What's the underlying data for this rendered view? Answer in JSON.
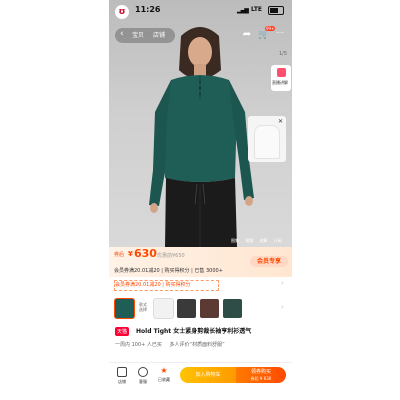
{
  "status": {
    "time": "11:26",
    "network": "LTE",
    "signal_icon": "signal-icon",
    "battery_icon": "battery-icon"
  },
  "nav": {
    "tabs": [
      "宝贝",
      "店铺"
    ],
    "pager": "1/5"
  },
  "live": {
    "label": "直播讲解"
  },
  "media_tabs": [
    "图集",
    "视频",
    "讲解",
    "尺码"
  ],
  "price": {
    "tag": "券后",
    "currency": "¥",
    "value": "630",
    "original": "优惠前¥650",
    "promo": "会员券满20.01减20 | 购买得积分  |  已售 3000+",
    "vip_button": "会员专享"
  },
  "coupon": {
    "text": "会员券满20.01减20 | 购买得积分"
  },
  "style_label": "款式\n选择",
  "product": {
    "badge": "天猫",
    "title": "Hold Tight 女士紧身剪裁长袖亨利衫透气"
  },
  "meta": [
    "一周内 100+ 人已买",
    "多人评价“材质面料舒服”"
  ],
  "bottom": {
    "items": [
      "店铺",
      "客服",
      "已收藏"
    ],
    "cart_button": "加入购物车",
    "buy_button": "领券购买",
    "buy_sub": "券后 ¥ 630"
  },
  "colors": {
    "accent": "#ff4a00",
    "tmall": "#ff0036",
    "shirt": "#1f5e57"
  }
}
